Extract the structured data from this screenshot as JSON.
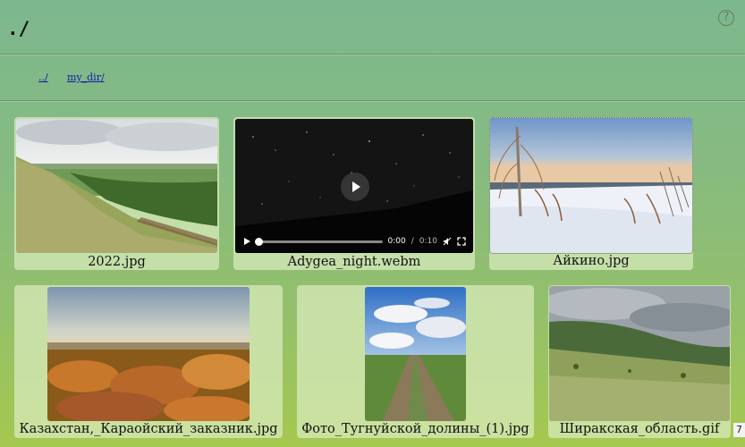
{
  "header": {
    "title": "./",
    "help_icon": "help-circle-icon",
    "help_glyph": "?"
  },
  "nav": {
    "links": [
      {
        "label": "../"
      },
      {
        "label": "my_dir/"
      }
    ]
  },
  "files": [
    {
      "name": "2022.jpg",
      "kind": "image"
    },
    {
      "name": "Adygea_night.webm",
      "kind": "video",
      "current_time": "0:00",
      "separator": "/",
      "duration": "0:10",
      "progress": 0
    },
    {
      "name": "Айкино.jpg",
      "kind": "image"
    },
    {
      "name": "Казахстан,_Караойский_заказник.jpg",
      "kind": "image"
    },
    {
      "name": "Фото_Тугнуйской_долины_(1).jpg",
      "kind": "image"
    },
    {
      "name": "Ширакская_область.gif",
      "kind": "image"
    }
  ],
  "counter": "7"
}
